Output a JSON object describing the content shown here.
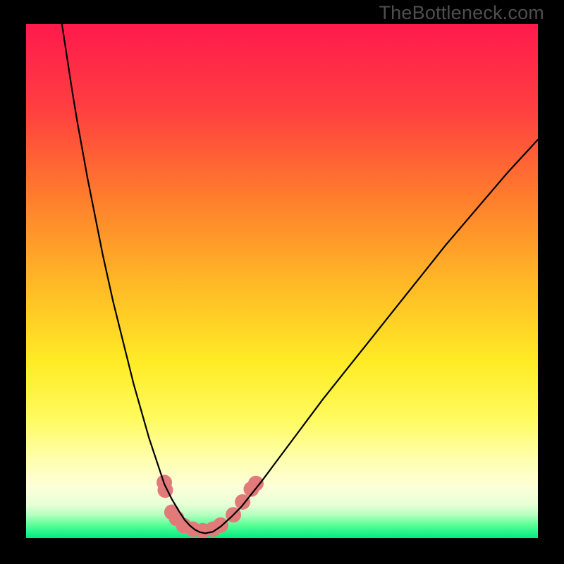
{
  "watermark": "TheBottleneck.com",
  "chart_data": {
    "type": "line",
    "title": "",
    "xlabel": "",
    "ylabel": "",
    "xlim": [
      0,
      100
    ],
    "ylim": [
      0,
      100
    ],
    "grid": false,
    "legend": false,
    "background_gradient_stops": [
      {
        "offset": 0.0,
        "color": "#ff1a4c"
      },
      {
        "offset": 0.17,
        "color": "#ff4040"
      },
      {
        "offset": 0.33,
        "color": "#ff7a2d"
      },
      {
        "offset": 0.5,
        "color": "#ffb726"
      },
      {
        "offset": 0.66,
        "color": "#ffec26"
      },
      {
        "offset": 0.77,
        "color": "#fffb60"
      },
      {
        "offset": 0.85,
        "color": "#ffffb0"
      },
      {
        "offset": 0.9,
        "color": "#fdffd8"
      },
      {
        "offset": 0.935,
        "color": "#e7ffd6"
      },
      {
        "offset": 0.955,
        "color": "#b6ffbf"
      },
      {
        "offset": 0.975,
        "color": "#59ff97"
      },
      {
        "offset": 1.0,
        "color": "#00eb81"
      }
    ],
    "series": [
      {
        "name": "bottleneck-curve",
        "color": "#000000",
        "stroke_width": 2.2,
        "x": [
          7.0,
          8.0,
          9.0,
          10.0,
          11.0,
          12.0,
          13.0,
          14.0,
          15.0,
          16.0,
          17.0,
          18.0,
          19.0,
          20.0,
          21.0,
          22.0,
          23.0,
          24.0,
          25.0,
          26.0,
          27.0,
          28.5,
          30.0,
          31.0,
          32.0,
          33.0,
          34.0,
          35.0,
          36.5,
          38.0,
          40.0,
          42.0,
          44.0,
          46.0,
          49.0,
          52.0,
          55.0,
          58.0,
          62.0,
          66.0,
          70.0,
          74.0,
          78.0,
          82.0,
          88.0,
          94.0,
          100.0
        ],
        "y": [
          100.0,
          93.5,
          87.0,
          81.0,
          75.5,
          70.0,
          65.0,
          60.0,
          55.0,
          50.5,
          46.0,
          42.0,
          38.0,
          34.0,
          30.0,
          26.5,
          23.0,
          19.5,
          16.5,
          13.5,
          10.5,
          7.5,
          5.0,
          3.5,
          2.4,
          1.6,
          1.1,
          0.9,
          1.2,
          2.2,
          4.0,
          6.0,
          8.5,
          11.0,
          15.0,
          19.0,
          23.0,
          27.0,
          32.0,
          37.0,
          42.0,
          47.0,
          52.0,
          57.0,
          64.0,
          71.0,
          77.5
        ]
      }
    ],
    "markers": {
      "name": "highlight-dots",
      "color": "#e27a7a",
      "radius": 11,
      "points": [
        {
          "x": 27.0,
          "y": 10.8
        },
        {
          "x": 27.2,
          "y": 9.3
        },
        {
          "x": 28.5,
          "y": 5.0
        },
        {
          "x": 29.4,
          "y": 3.8
        },
        {
          "x": 30.8,
          "y": 2.4
        },
        {
          "x": 32.6,
          "y": 1.7
        },
        {
          "x": 34.5,
          "y": 1.4
        },
        {
          "x": 36.5,
          "y": 1.7
        },
        {
          "x": 38.0,
          "y": 2.5
        },
        {
          "x": 40.5,
          "y": 4.5
        },
        {
          "x": 42.3,
          "y": 7.0
        },
        {
          "x": 44.0,
          "y": 9.5
        },
        {
          "x": 44.9,
          "y": 10.6
        }
      ]
    }
  }
}
